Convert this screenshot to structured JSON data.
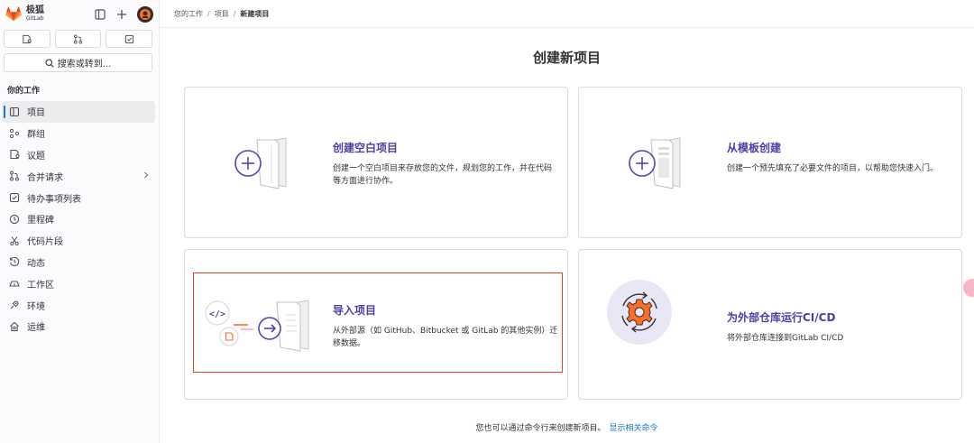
{
  "brand": {
    "name_cn": "极狐",
    "name_en": "GitLab"
  },
  "search": {
    "label": "搜索或转到..."
  },
  "sidebar": {
    "section_title": "你的工作",
    "items": [
      {
        "label": "项目",
        "icon": "project-icon"
      },
      {
        "label": "群组",
        "icon": "group-icon"
      },
      {
        "label": "议题",
        "icon": "issue-icon"
      },
      {
        "label": "合并请求",
        "icon": "merge-request-icon"
      },
      {
        "label": "待办事项列表",
        "icon": "todo-icon"
      },
      {
        "label": "里程碑",
        "icon": "milestone-icon"
      },
      {
        "label": "代码片段",
        "icon": "snippet-icon"
      },
      {
        "label": "动态",
        "icon": "activity-icon"
      },
      {
        "label": "工作区",
        "icon": "workspace-icon"
      },
      {
        "label": "环境",
        "icon": "environment-icon"
      },
      {
        "label": "运维",
        "icon": "operations-icon"
      }
    ]
  },
  "breadcrumb": {
    "items": [
      "您的工作",
      "项目",
      "新建项目"
    ]
  },
  "page": {
    "title": "创建新项目"
  },
  "cards": [
    {
      "title": "创建空白项目",
      "desc": "创建一个空白项目来存放您的文件，规划您的工作，并在代码等方面进行协作。"
    },
    {
      "title": "从模板创建",
      "desc": "创建一个预先填充了必要文件的项目，以帮助您快速入门。"
    },
    {
      "title": "导入项目",
      "desc": "从外部源（如 GitHub、Bitbucket 或 GitLab 的其他实例）迁移数据。"
    },
    {
      "title": "为外部仓库运行CI/CD",
      "desc": "将外部仓库连接到GitLab CI/CD"
    }
  ],
  "footer": {
    "text": "您也可以通过命令行来创建新项目。",
    "link": "显示相关命令"
  },
  "colors": {
    "accent": "#4b3fa6",
    "highlight": "#e24329",
    "link": "#1f75cb"
  }
}
